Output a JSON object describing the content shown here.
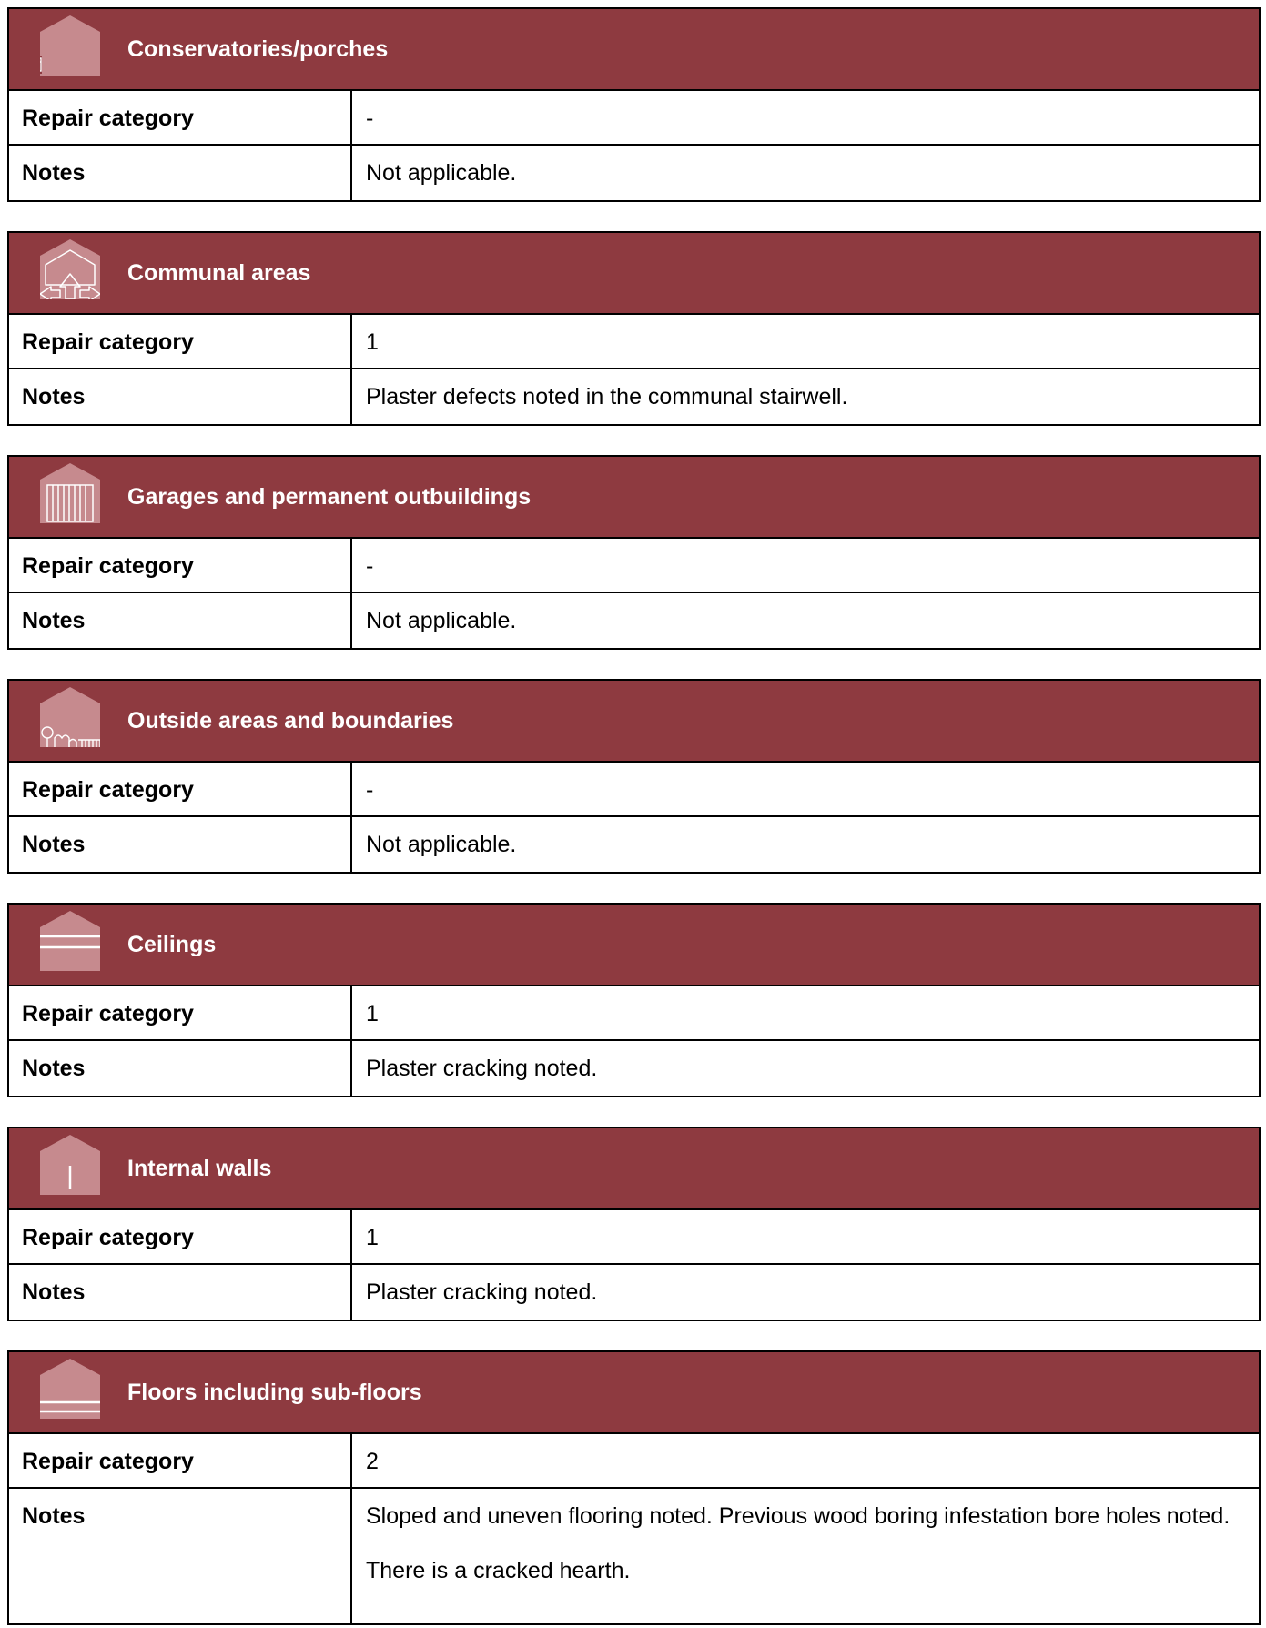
{
  "colors": {
    "header_bg": "#8e3a40",
    "header_text": "#ffffff",
    "icon_fill": "#c68a8e"
  },
  "sections": [
    {
      "title": "Conservatories/porches",
      "icon": "conservatory-icon",
      "repair_label": "Repair category",
      "repair_value": "-",
      "notes_label": "Notes",
      "notes": [
        "Not applicable."
      ]
    },
    {
      "title": "Communal areas",
      "icon": "communal-areas-icon",
      "repair_label": "Repair category",
      "repair_value": "1",
      "notes_label": "Notes",
      "notes": [
        "Plaster defects noted in the communal stairwell."
      ]
    },
    {
      "title": "Garages and permanent outbuildings",
      "icon": "garage-icon",
      "repair_label": "Repair category",
      "repair_value": "-",
      "notes_label": "Notes",
      "notes": [
        "Not applicable."
      ]
    },
    {
      "title": "Outside areas and boundaries",
      "icon": "outside-areas-icon",
      "repair_label": "Repair category",
      "repair_value": "-",
      "notes_label": "Notes",
      "notes": [
        "Not applicable."
      ]
    },
    {
      "title": "Ceilings",
      "icon": "ceilings-icon",
      "repair_label": "Repair category",
      "repair_value": "1",
      "notes_label": "Notes",
      "notes": [
        "Plaster cracking noted."
      ]
    },
    {
      "title": "Internal walls",
      "icon": "internal-walls-icon",
      "repair_label": "Repair category",
      "repair_value": "1",
      "notes_label": "Notes",
      "notes": [
        "Plaster cracking noted."
      ]
    },
    {
      "title": "Floors including sub-floors",
      "icon": "floors-icon",
      "repair_label": "Repair category",
      "repair_value": "2",
      "notes_label": "Notes",
      "notes": [
        "Sloped and uneven flooring noted.  Previous wood boring infestation bore holes noted.",
        "There is a cracked hearth."
      ]
    }
  ]
}
